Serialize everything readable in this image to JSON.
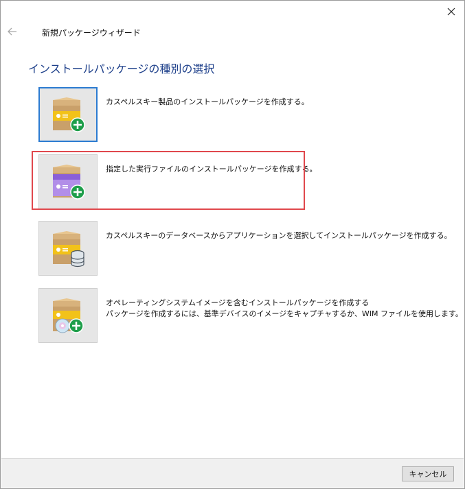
{
  "window": {
    "title": "新規パッケージウィザード",
    "close_icon": "close-icon",
    "back_icon": "back-arrow-icon"
  },
  "heading": "インストールパッケージの種別の選択",
  "options": [
    {
      "label": "カスペルスキー製品のインストールパッケージを作成する。",
      "icon": "package-add-icon",
      "selected": true
    },
    {
      "label": "指定した実行ファイルのインストールパッケージを作成する。",
      "icon": "package-executable-add-icon",
      "highlighted": true
    },
    {
      "label": "カスペルスキーのデータベースからアプリケーションを選択してインストールパッケージを作成する。",
      "icon": "package-database-icon"
    },
    {
      "label_line1": "オペレーティングシステムイメージを含むインストールパッケージを作成する",
      "label_line2": "パッケージを作成するには、基準デバイスのイメージをキャプチャするか、WIM ファイルを使用します。",
      "icon": "package-os-image-icon"
    }
  ],
  "footer": {
    "cancel_label": "キャンセル"
  },
  "colors": {
    "heading": "#1d3f8a",
    "selection_border": "#2b7bd1",
    "highlight": "#e0474c",
    "add_badge": "#1e9e4a"
  }
}
